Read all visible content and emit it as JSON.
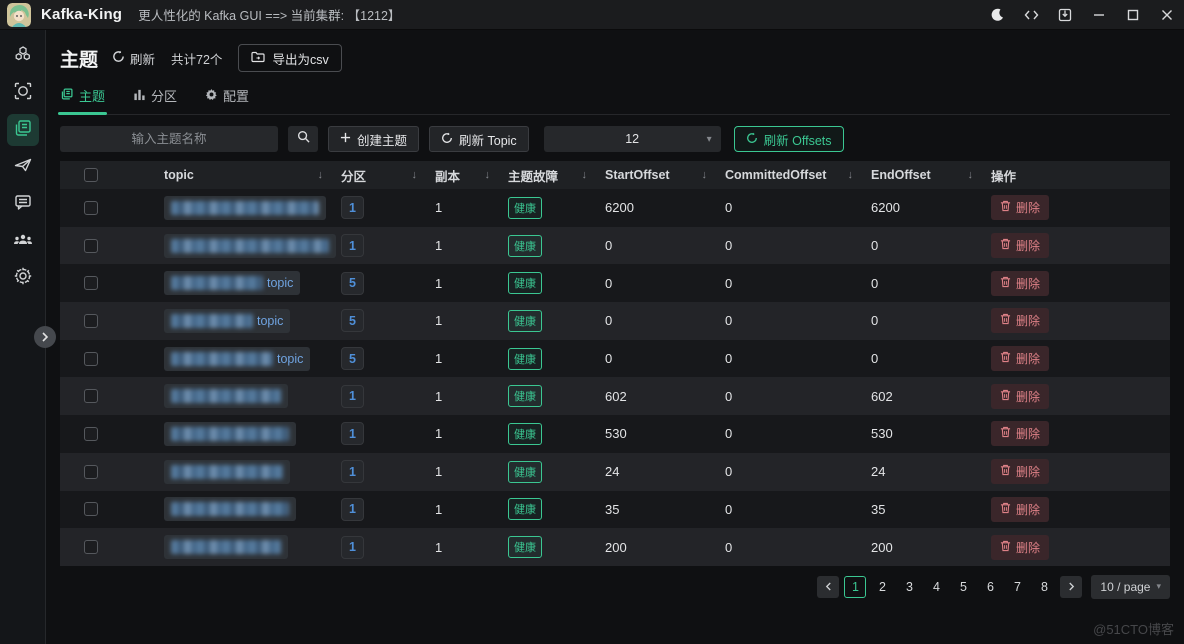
{
  "titlebar": {
    "app_name": "Kafka-King",
    "subtitle": "更人性化的 Kafka GUI ==> 当前集群: 【1212】"
  },
  "sidebar": {
    "items": [
      {
        "name": "cluster",
        "active": false
      },
      {
        "name": "monitor",
        "active": false
      },
      {
        "name": "topics",
        "active": true
      },
      {
        "name": "producer",
        "active": false
      },
      {
        "name": "messages",
        "active": false
      },
      {
        "name": "consumer-groups",
        "active": false
      },
      {
        "name": "settings",
        "active": false
      }
    ]
  },
  "page_header": {
    "title": "主题",
    "refresh_label": "刷新",
    "total_label": "共计72个",
    "export_csv_label": "导出为csv"
  },
  "tabs": [
    {
      "label": "主题",
      "active": true
    },
    {
      "label": "分区",
      "active": false
    },
    {
      "label": "配置",
      "active": false
    }
  ],
  "toolbar": {
    "search_placeholder": "输入主题名称",
    "create_topic_label": "创建主题",
    "refresh_topic_label": "刷新 Topic",
    "page_size_value": "12",
    "refresh_offsets_label": "刷新 Offsets"
  },
  "table": {
    "columns": [
      {
        "label": "topic",
        "sortable": true
      },
      {
        "label": "分区",
        "sortable": true
      },
      {
        "label": "副本",
        "sortable": true
      },
      {
        "label": "主题故障",
        "sortable": true
      },
      {
        "label": "StartOffset",
        "sortable": true
      },
      {
        "label": "CommittedOffset",
        "sortable": true
      },
      {
        "label": "EndOffset",
        "sortable": true
      },
      {
        "label": "操作",
        "sortable": false
      }
    ],
    "delete_label": "删除",
    "rows": [
      {
        "topic_redacted": true,
        "redact_width": 148,
        "topic_suffix": "",
        "partitions": "1",
        "replicas": "1",
        "health": "健康",
        "start_offset": "6200",
        "committed_offset": "0",
        "end_offset": "6200"
      },
      {
        "topic_redacted": true,
        "redact_width": 158,
        "topic_suffix": "",
        "partitions": "1",
        "replicas": "1",
        "health": "健康",
        "start_offset": "0",
        "committed_offset": "0",
        "end_offset": "0"
      },
      {
        "topic_redacted": true,
        "redact_width": 92,
        "topic_suffix": "topic",
        "partitions": "5",
        "replicas": "1",
        "health": "健康",
        "start_offset": "0",
        "committed_offset": "0",
        "end_offset": "0"
      },
      {
        "topic_redacted": true,
        "redact_width": 82,
        "topic_suffix": "topic",
        "partitions": "5",
        "replicas": "1",
        "health": "健康",
        "start_offset": "0",
        "committed_offset": "0",
        "end_offset": "0"
      },
      {
        "topic_redacted": true,
        "redact_width": 102,
        "topic_suffix": "topic",
        "partitions": "5",
        "replicas": "1",
        "health": "健康",
        "start_offset": "0",
        "committed_offset": "0",
        "end_offset": "0"
      },
      {
        "topic_redacted": true,
        "redact_width": 110,
        "topic_suffix": "",
        "partitions": "1",
        "replicas": "1",
        "health": "健康",
        "start_offset": "602",
        "committed_offset": "0",
        "end_offset": "602"
      },
      {
        "topic_redacted": true,
        "redact_width": 118,
        "topic_suffix": "",
        "partitions": "1",
        "replicas": "1",
        "health": "健康",
        "start_offset": "530",
        "committed_offset": "0",
        "end_offset": "530"
      },
      {
        "topic_redacted": true,
        "redact_width": 112,
        "topic_suffix": "",
        "partitions": "1",
        "replicas": "1",
        "health": "健康",
        "start_offset": "24",
        "committed_offset": "0",
        "end_offset": "24"
      },
      {
        "topic_redacted": true,
        "redact_width": 118,
        "topic_suffix": "",
        "partitions": "1",
        "replicas": "1",
        "health": "健康",
        "start_offset": "35",
        "committed_offset": "0",
        "end_offset": "35"
      },
      {
        "topic_redacted": true,
        "redact_width": 110,
        "topic_suffix": "",
        "partitions": "1",
        "replicas": "1",
        "health": "健康",
        "start_offset": "200",
        "committed_offset": "0",
        "end_offset": "200"
      }
    ]
  },
  "pagination": {
    "prev": "‹",
    "next": "›",
    "pages": [
      "1",
      "2",
      "3",
      "4",
      "5",
      "6",
      "7",
      "8"
    ],
    "active_page": "1",
    "page_size_label": "10 / page"
  },
  "watermark": "@51CTO博客",
  "colors": {
    "accent": "#3bc792",
    "link_blue": "#4f8fd8",
    "danger": "#de8187"
  }
}
